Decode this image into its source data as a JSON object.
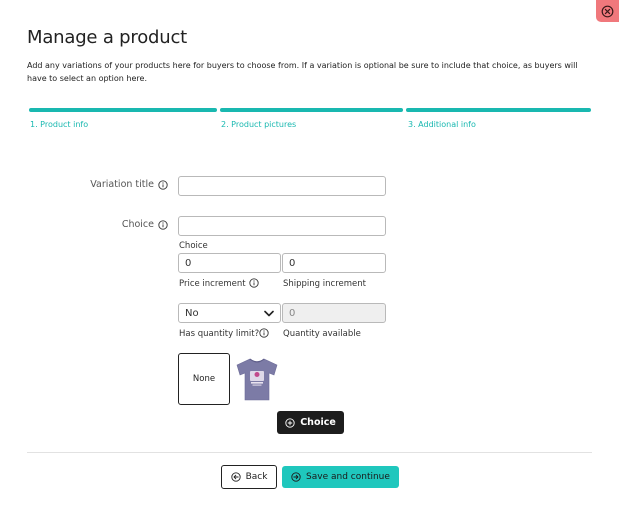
{
  "header": {
    "title": "Manage a product",
    "description": "Add any variations of your products here for buyers to choose from. If a variation is optional be sure to include that choice, as buyers will have to select an option here."
  },
  "steps": [
    {
      "label": "1. Product info"
    },
    {
      "label": "2. Product pictures"
    },
    {
      "label": "3. Additional info"
    }
  ],
  "form": {
    "variation_title_label": "Variation title",
    "variation_title_value": "",
    "choice_label": "Choice",
    "choice_value": "",
    "choice_sub_label": "Choice",
    "price_increment_value": "0",
    "price_increment_label": "Price increment",
    "shipping_increment_value": "0",
    "shipping_increment_label": "Shipping increment",
    "quantity_limit_value": "No",
    "quantity_limit_label": "Has quantity limit?",
    "quantity_available_value": "0",
    "quantity_available_label": "Quantity available"
  },
  "images": {
    "none_label": "None",
    "shirt_icon": "tshirt-thumbnail"
  },
  "buttons": {
    "add_choice": "Choice",
    "back": "Back",
    "save": "Save and continue"
  },
  "colors": {
    "accent": "#19b8b0",
    "save_button": "#1fc7bd",
    "close_button": "#f0787c",
    "dark_button": "#1d1d1d"
  }
}
